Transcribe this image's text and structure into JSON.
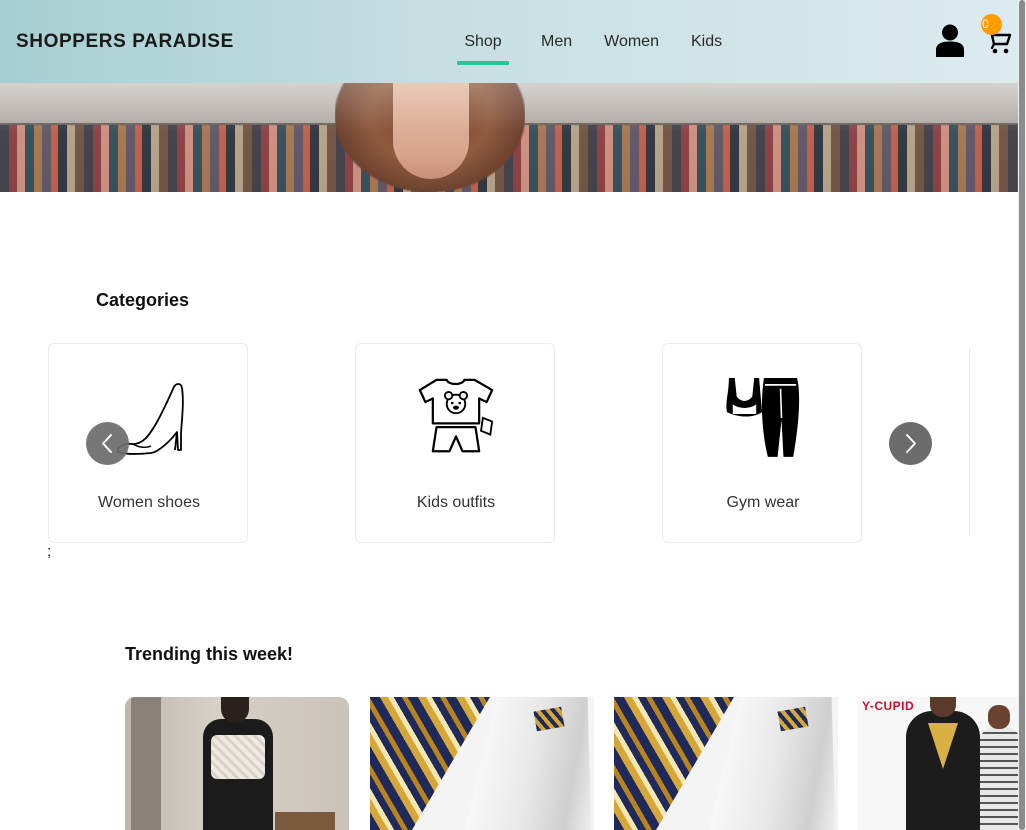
{
  "header": {
    "brand": "SHOPPERS PARADISE",
    "nav": [
      "Shop",
      "Men",
      "Women",
      "Kids"
    ],
    "active_nav": "Shop",
    "cart_count": "0",
    "icons": [
      "user-icon",
      "cart-icon"
    ]
  },
  "categories": {
    "title": "Categories",
    "items": [
      {
        "label": "Women shoes",
        "icon": "high-heel-shoe-icon"
      },
      {
        "label": "Kids outfits",
        "icon": "kids-outfit-icon"
      },
      {
        "label": "Gym wear",
        "icon": "gym-wear-icon"
      }
    ],
    "stray_text": ";"
  },
  "trending": {
    "title": "Trending this week!",
    "logo_text": "Y-CUPID"
  },
  "colors": {
    "accent": "#22c996",
    "badge": "#ff9c00",
    "carousel_button": "#6c6c6c"
  }
}
